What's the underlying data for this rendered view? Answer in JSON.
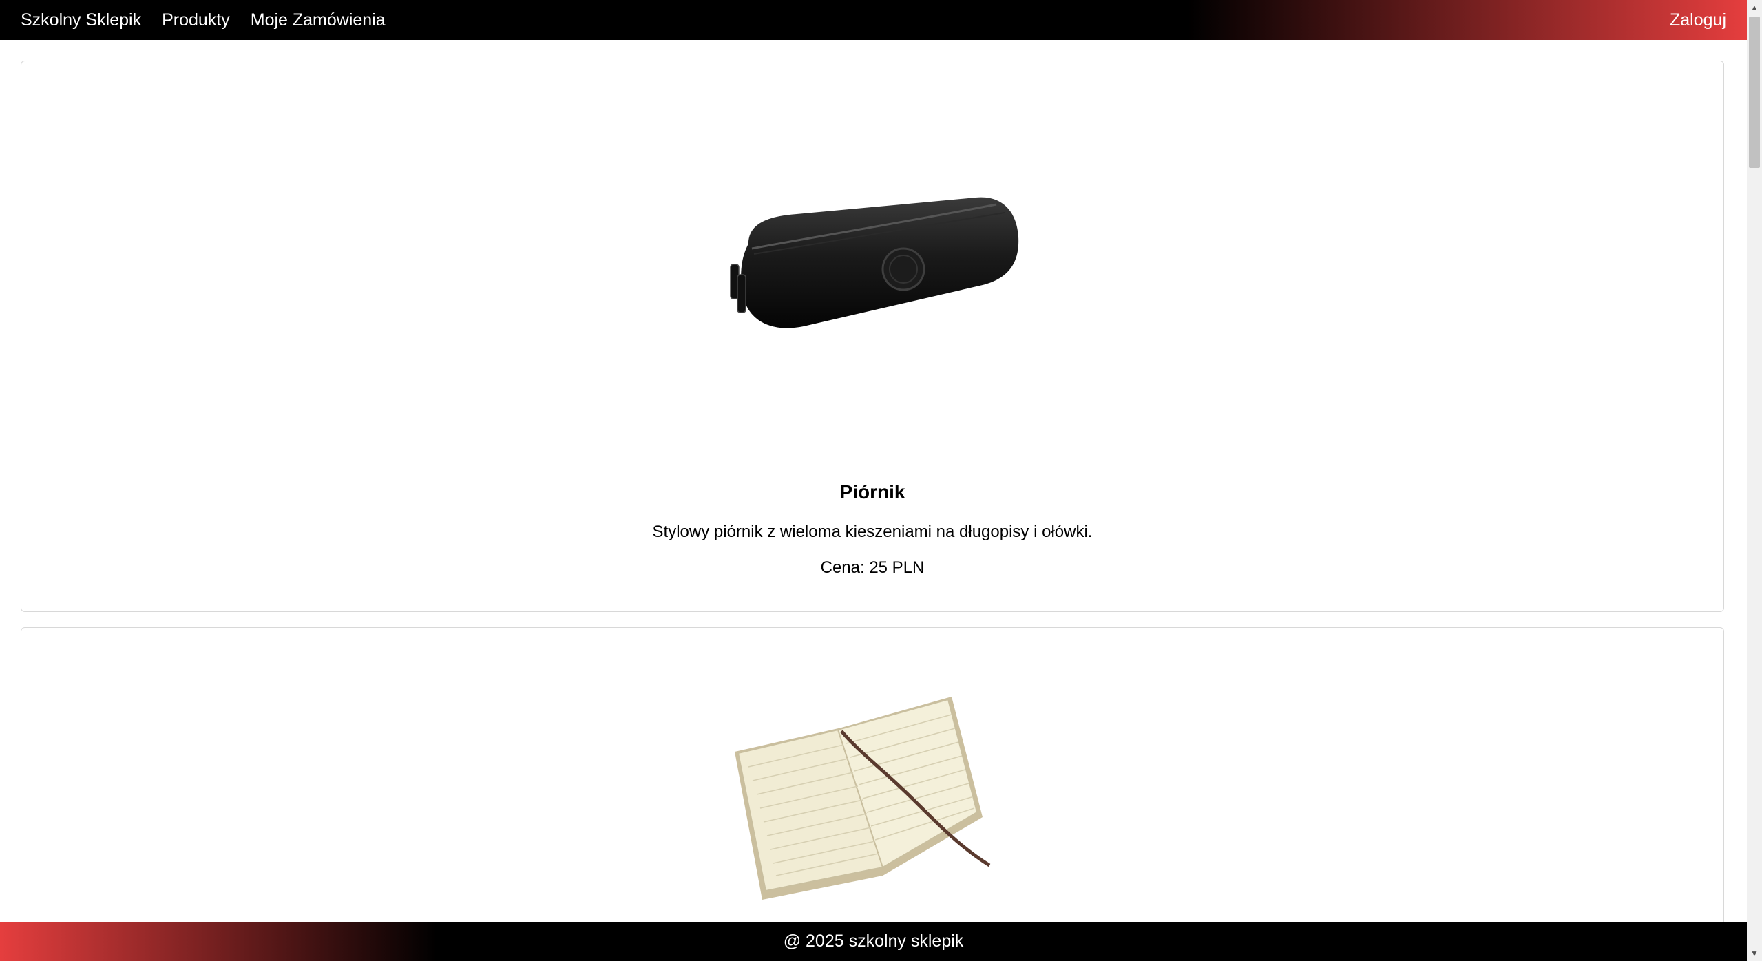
{
  "navbar": {
    "brand": "Szkolny Sklepik",
    "links": [
      "Produkty",
      "Moje Zamówienia"
    ],
    "login": "Zaloguj"
  },
  "products": [
    {
      "name": "Piórnik",
      "description": "Stylowy piórnik z wieloma kieszeniami na długopisy i ołówki.",
      "price": "Cena: 25 PLN",
      "image": "pencil-case-image"
    },
    {
      "image": "notebook-image"
    }
  ],
  "footer": {
    "text": "@ 2025 szkolny sklepik"
  },
  "colors": {
    "accent": "#e53e3e",
    "nav_background": "#000000"
  }
}
